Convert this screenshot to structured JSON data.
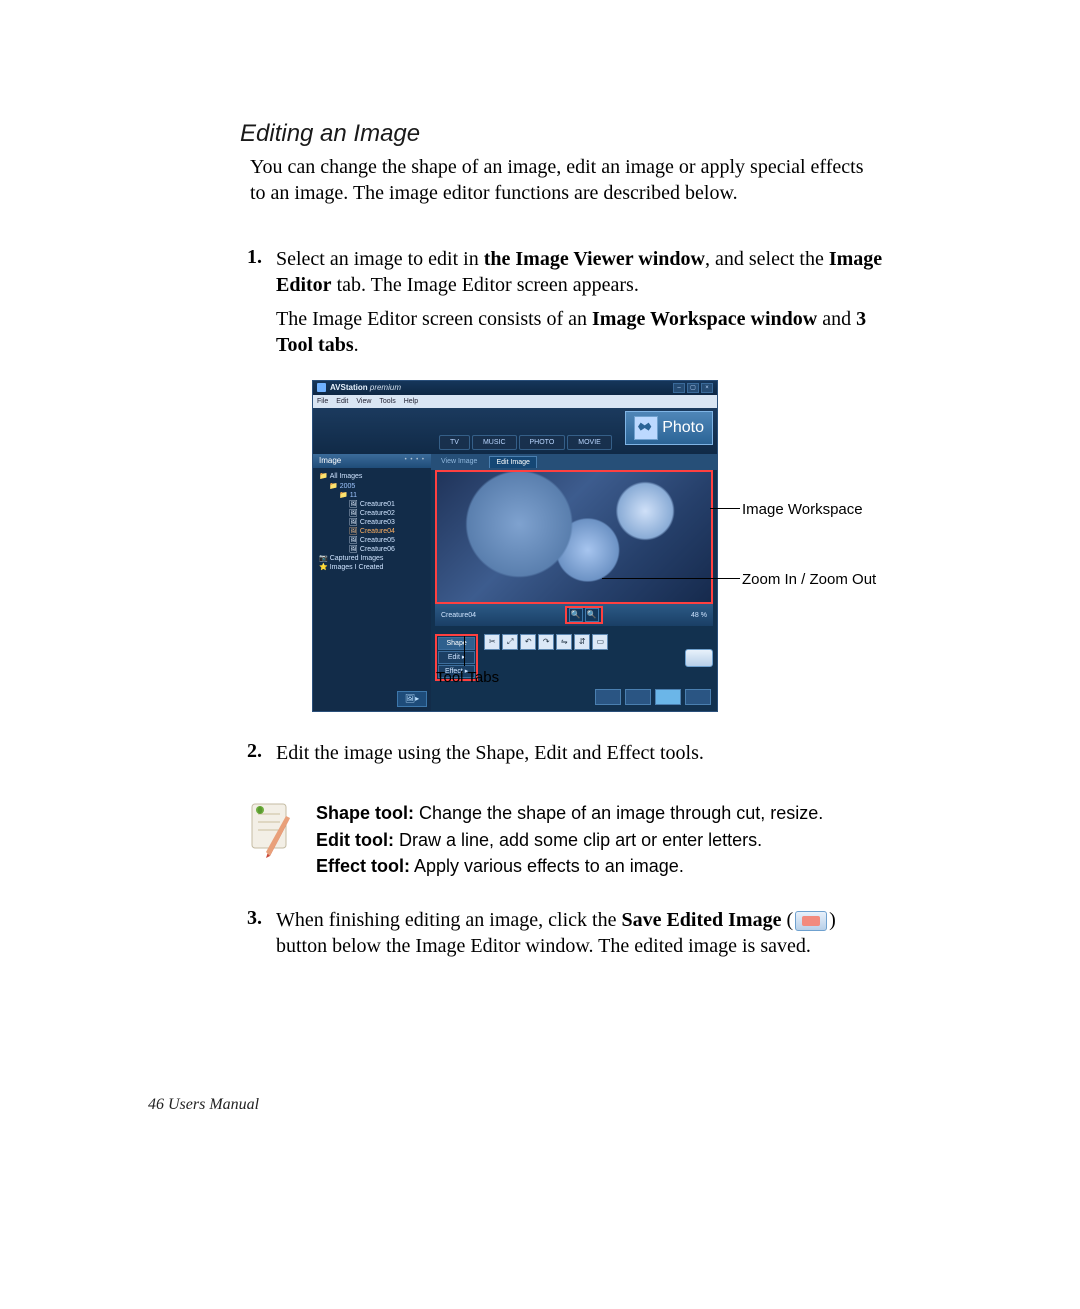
{
  "section_title": "Editing an Image",
  "intro": "You can change the shape of an image, edit an image or apply special effects to an image. The image editor functions are described below.",
  "steps": {
    "s1": {
      "num": "1.",
      "l1a": "Select an image to edit in ",
      "l1b": "the Image Viewer window",
      "l1c": ", and select the ",
      "l1d": "Image Editor",
      "l1e": " tab. The Image Editor screen appears.",
      "l2a": "The Image Editor screen consists of an ",
      "l2b": "Image Workspace window",
      "l2c": " and ",
      "l2d": "3 Tool tabs",
      "l2e": "."
    },
    "s2": {
      "num": "2.",
      "text": "Edit the image using the Shape, Edit and Effect tools."
    },
    "s3": {
      "num": "3.",
      "a": "When finishing editing an image, click the ",
      "b": "Save Edited Image",
      "c": " (",
      "d": ") button below the Image Editor window. The edited image is saved."
    }
  },
  "tools_desc": {
    "shape_label": "Shape tool:",
    "shape_text": " Change the shape of an image through cut, resize.",
    "edit_label": "Edit tool:",
    "edit_text": " Draw a line, add some clip art or enter letters.",
    "effect_label": "Effect tool:",
    "effect_text": " Apply various effects to an image."
  },
  "app": {
    "title_a": "AVStation",
    "title_b": " premium",
    "menu": [
      "File",
      "Edit",
      "View",
      "Tools",
      "Help"
    ],
    "modules": [
      "TV",
      "MUSIC",
      "PHOTO",
      "MOVIE"
    ],
    "photo_label": "Photo",
    "sidebar_header": "Image",
    "tree": {
      "root": "All Images",
      "year": "2005",
      "month": "11",
      "items": [
        "Creature01",
        "Creature02",
        "Creature03",
        "Creature04",
        "Creature05",
        "Creature06"
      ],
      "captured": "Captured Images",
      "created": "Images I Created"
    },
    "subtabs": {
      "view": "View Image",
      "edit": "Edit Image"
    },
    "filename": "Creature04",
    "size_label": "48  %",
    "tooltabs": [
      "Shape",
      "Edit  ▸",
      "Effect ▸"
    ]
  },
  "callouts": {
    "workspace": "Image Workspace",
    "zoom": "Zoom In / Zoom Out",
    "tooltabs": "Tool Tabs"
  },
  "footer": "46  Users Manual"
}
